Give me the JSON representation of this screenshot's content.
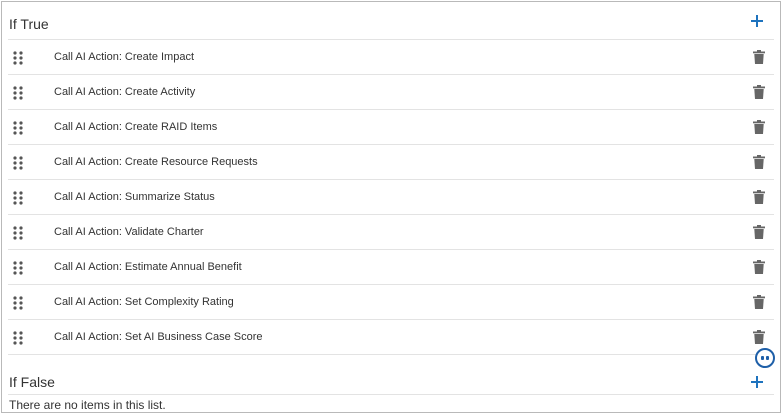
{
  "if_true": {
    "title": "If True",
    "add_label": "+",
    "items": [
      {
        "label": "Call AI Action: Create Impact"
      },
      {
        "label": "Call AI Action: Create Activity"
      },
      {
        "label": "Call AI Action: Create RAID Items"
      },
      {
        "label": "Call AI Action: Create Resource Requests"
      },
      {
        "label": "Call AI Action: Summarize Status"
      },
      {
        "label": "Call AI Action: Validate Charter"
      },
      {
        "label": "Call AI Action: Estimate Annual Benefit"
      },
      {
        "label": "Call AI Action: Set Complexity Rating"
      },
      {
        "label": "Call AI Action: Set AI Business Case Score"
      }
    ]
  },
  "if_false": {
    "title": "If False",
    "add_label": "+",
    "empty_message": "There are no items in this list."
  },
  "icons": {
    "drag": "drag-handle-icon",
    "delete": "trash-icon",
    "add": "plus-icon",
    "chat": "chat-assistant-icon"
  },
  "colors": {
    "accent": "#1e73be",
    "icon_gray": "#666666",
    "border": "#e3e3e3",
    "frame_border": "#b9b9b9"
  }
}
